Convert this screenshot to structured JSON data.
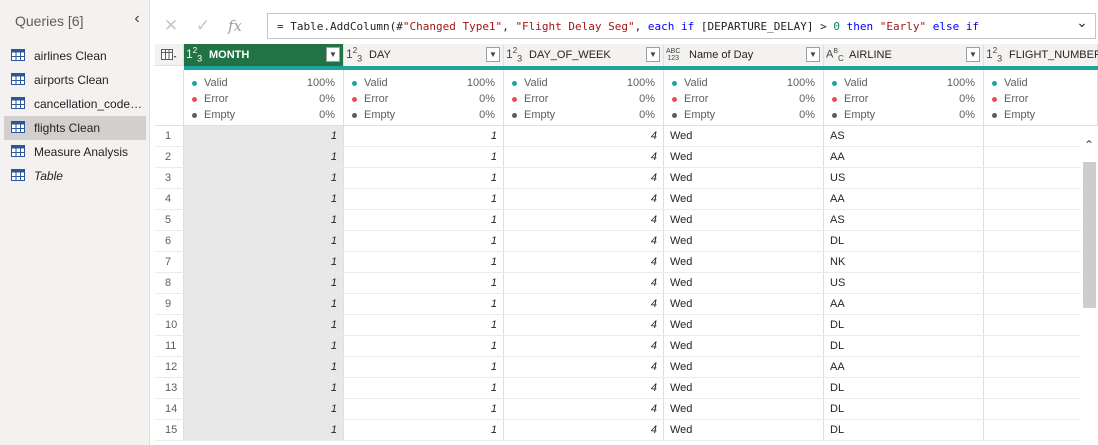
{
  "queries_pane": {
    "title": "Queries [6]",
    "collapse_icon": "chevron-left-icon",
    "items": [
      {
        "label": "airlines Clean",
        "italic": false,
        "selected": false
      },
      {
        "label": "airports Clean",
        "italic": false,
        "selected": false
      },
      {
        "label": "cancellation_codes...",
        "italic": false,
        "selected": false
      },
      {
        "label": "flights Clean",
        "italic": false,
        "selected": true
      },
      {
        "label": "Measure Analysis",
        "italic": false,
        "selected": false
      },
      {
        "label": "Table",
        "italic": true,
        "selected": false
      }
    ]
  },
  "formula_bar": {
    "cancel_icon": "close-icon",
    "commit_icon": "check-icon",
    "fx_label": "fx",
    "segments": [
      {
        "t": "= Table.AddColumn(#",
        "c": ""
      },
      {
        "t": "\"Changed Type1\"",
        "c": "str"
      },
      {
        "t": ", ",
        "c": ""
      },
      {
        "t": "\"Flight Delay Seg\"",
        "c": "str"
      },
      {
        "t": ", ",
        "c": ""
      },
      {
        "t": "each if",
        "c": "kw"
      },
      {
        "t": " [DEPARTURE_DELAY] > ",
        "c": ""
      },
      {
        "t": "0",
        "c": "num"
      },
      {
        "t": " then ",
        "c": "kw"
      },
      {
        "t": "\"Early\"",
        "c": "str"
      },
      {
        "t": " else if",
        "c": "kw"
      }
    ],
    "expand_icon": "chevron-down-icon"
  },
  "colors": {
    "selected_header": "#217346",
    "quality_bar": "#1fa39b",
    "valid": "#1fa39b",
    "error": "#e8504f",
    "empty": "#605e5c"
  },
  "columns": [
    {
      "name": "MONTH",
      "type_label": "1²₃",
      "type": "number",
      "selected": true
    },
    {
      "name": "DAY",
      "type_label": "1²₃",
      "type": "number",
      "selected": false
    },
    {
      "name": "DAY_OF_WEEK",
      "type_label": "1²₃",
      "type": "number",
      "selected": false
    },
    {
      "name": "Name of Day",
      "type_label": "ABC/123",
      "type": "any",
      "selected": false
    },
    {
      "name": "AIRLINE",
      "type_label": "AᴮC",
      "type": "text",
      "selected": false
    },
    {
      "name": "FLIGHT_NUMBER",
      "type_label": "1²₃",
      "type": "number",
      "selected": false
    }
  ],
  "quality": [
    {
      "valid": "100%",
      "error": "0%",
      "empty": "0%"
    },
    {
      "valid": "100%",
      "error": "0%",
      "empty": "0%"
    },
    {
      "valid": "100%",
      "error": "0%",
      "empty": "0%"
    },
    {
      "valid": "100%",
      "error": "0%",
      "empty": "0%"
    },
    {
      "valid": "100%",
      "error": "0%",
      "empty": "0%"
    },
    {
      "valid": "",
      "error": "",
      "empty": ""
    }
  ],
  "quality_labels": {
    "valid": "Valid",
    "error": "Error",
    "empty": "Empty"
  },
  "rows": [
    {
      "n": "1",
      "cells": [
        "1",
        "1",
        "4",
        "Wed",
        "AS",
        ""
      ]
    },
    {
      "n": "2",
      "cells": [
        "1",
        "1",
        "4",
        "Wed",
        "AA",
        ""
      ]
    },
    {
      "n": "3",
      "cells": [
        "1",
        "1",
        "4",
        "Wed",
        "US",
        ""
      ]
    },
    {
      "n": "4",
      "cells": [
        "1",
        "1",
        "4",
        "Wed",
        "AA",
        ""
      ]
    },
    {
      "n": "5",
      "cells": [
        "1",
        "1",
        "4",
        "Wed",
        "AS",
        ""
      ]
    },
    {
      "n": "6",
      "cells": [
        "1",
        "1",
        "4",
        "Wed",
        "DL",
        ""
      ]
    },
    {
      "n": "7",
      "cells": [
        "1",
        "1",
        "4",
        "Wed",
        "NK",
        ""
      ]
    },
    {
      "n": "8",
      "cells": [
        "1",
        "1",
        "4",
        "Wed",
        "US",
        ""
      ]
    },
    {
      "n": "9",
      "cells": [
        "1",
        "1",
        "4",
        "Wed",
        "AA",
        ""
      ]
    },
    {
      "n": "10",
      "cells": [
        "1",
        "1",
        "4",
        "Wed",
        "DL",
        ""
      ]
    },
    {
      "n": "11",
      "cells": [
        "1",
        "1",
        "4",
        "Wed",
        "DL",
        ""
      ]
    },
    {
      "n": "12",
      "cells": [
        "1",
        "1",
        "4",
        "Wed",
        "AA",
        ""
      ]
    },
    {
      "n": "13",
      "cells": [
        "1",
        "1",
        "4",
        "Wed",
        "DL",
        ""
      ]
    },
    {
      "n": "14",
      "cells": [
        "1",
        "1",
        "4",
        "Wed",
        "DL",
        ""
      ]
    },
    {
      "n": "15",
      "cells": [
        "1",
        "1",
        "4",
        "Wed",
        "DL",
        ""
      ]
    }
  ]
}
